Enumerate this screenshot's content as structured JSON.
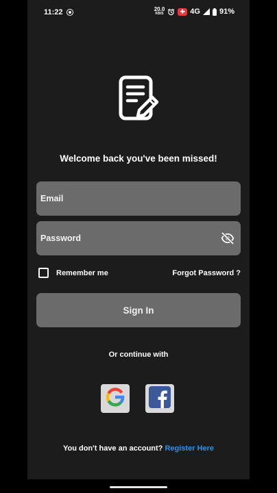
{
  "status_bar": {
    "time": "11:22",
    "net_speed_value": "20.0",
    "net_speed_unit": "KB/S",
    "network": "4G",
    "battery": "91%",
    "icons": [
      "record-icon",
      "alarm-icon",
      "vpn-icon",
      "signal-icon",
      "battery-icon"
    ]
  },
  "logo": {
    "icon": "note-edit-icon"
  },
  "welcome": "Welcome back you've been missed!",
  "email": {
    "placeholder": "Email",
    "value": ""
  },
  "password": {
    "placeholder": "Password",
    "value": "",
    "visibility_icon": "visibility-off-icon"
  },
  "remember": {
    "label": "Remember me",
    "checked": false
  },
  "forgot": "Forgot Password ?",
  "sign_in": "Sign In",
  "continue_with": "Or continue with",
  "social": [
    {
      "name": "google",
      "icon": "google-icon"
    },
    {
      "name": "facebook",
      "icon": "facebook-icon"
    }
  ],
  "register": {
    "prompt": "You don't have an account?",
    "link": "Register Here"
  },
  "colors": {
    "background": "#1c1c1c",
    "field": "#6b6b6b",
    "link": "#2f8fe8",
    "social_bg": "#d9d9d9",
    "facebook": "#3b5998"
  }
}
